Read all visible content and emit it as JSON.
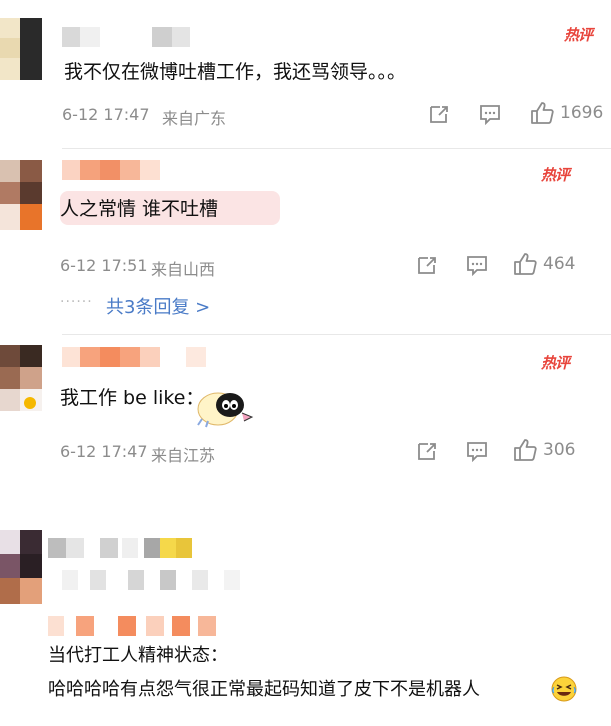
{
  "comments": [
    {
      "hot_label": "热评",
      "text": "我不仅在微博吐槽工作，我还骂领导。。。",
      "time": "6-12 17:47",
      "source": "来自广东",
      "likes": "1696",
      "icons": [
        "share-icon",
        "comment-icon",
        "like-icon"
      ]
    },
    {
      "hot_label": "热评",
      "text": "人之常情 谁不吐槽",
      "time": "6-12 17:51",
      "source": "来自山西",
      "likes": "464",
      "replies_link": "共3条回复 >",
      "icons": [
        "share-icon",
        "comment-icon",
        "like-icon"
      ]
    },
    {
      "hot_label": "热评",
      "text": "我工作 be like：",
      "time": "6-12 17:47",
      "source": "来自江苏",
      "likes": "306",
      "icons": [
        "share-icon",
        "comment-icon",
        "like-icon",
        "cartoon-sticker-icon"
      ]
    },
    {
      "line1": "当代打工人精神状态：",
      "line2": "哈哈哈哈有点怨气很正常最起码知道了皮下不是机器人",
      "icons": [
        "laughing-cry-emoji-icon"
      ]
    }
  ],
  "colors": {
    "hot": "#e8453c",
    "link": "#4a7bc7",
    "meta": "#8c8c8c",
    "divider": "#e8e8e8"
  }
}
